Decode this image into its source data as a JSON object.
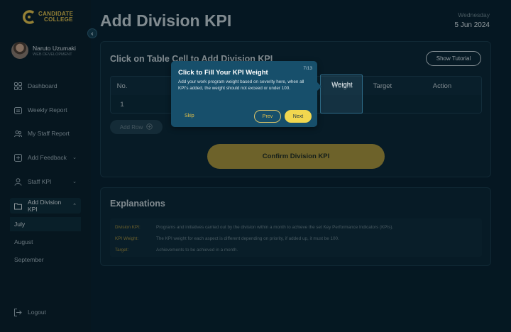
{
  "brand": {
    "line1": "CANDIDATE",
    "line2": "COLLEGE",
    "accent": "#e3c14a"
  },
  "profile": {
    "name": "Naruto Uzumaki",
    "role": "WEB DEVELOPMENT"
  },
  "nav": {
    "dashboard": "Dashboard",
    "weekly_report": "Weekly Report",
    "my_staff_report": "My Staff Report",
    "add_feedback": "Add Feedback",
    "staff_kpi": "Staff KPI",
    "add_division_kpi": "Add Division KPI",
    "sub_items": [
      "July",
      "August",
      "September"
    ],
    "logout": "Logout"
  },
  "header": {
    "title": "Add Division KPI",
    "day": "Wednesday",
    "date": "5 Jun 2024"
  },
  "kpi_card": {
    "heading": "Click on Table Cell to Add Division KPI",
    "tutorial_button": "Show Tutorial",
    "columns": [
      "No.",
      "Weight",
      "Target",
      "Action"
    ],
    "rows": [
      [
        "1",
        "",
        "",
        ""
      ]
    ],
    "add_row": "Add Row",
    "confirm": "Confirm Division KPI"
  },
  "explanations": {
    "heading": "Explanations",
    "items": [
      {
        "term": "Division KPI:",
        "definition": "Programs and initiatives carried out by the division within a month to achieve the set Key Performance Indicators (KPIs)."
      },
      {
        "term": "KPI Weight:",
        "definition": "The KPI weight for each aspect is different depending on priority, if added up, it must be 100."
      },
      {
        "term": "Target:",
        "definition": "Achievements to be achieved in a month."
      }
    ]
  },
  "tour": {
    "title": "Click to Fill Your KPI Weight",
    "step": "7/13",
    "body": "Add your work program weight based on severity here, when all KPI's added, the weight should not exceed or under 100.",
    "skip": "Skip",
    "prev": "Prev",
    "next": "Next",
    "highlight_label": "Weight"
  },
  "icons": {
    "dashboard": "grid-icon",
    "weekly": "calendar-icon",
    "staff": "users-icon",
    "feedback": "plus-square-icon",
    "staff_kpi": "user-icon",
    "division_kpi": "folder-icon",
    "logout": "logout-icon",
    "add_row": "plus-circle-icon"
  }
}
